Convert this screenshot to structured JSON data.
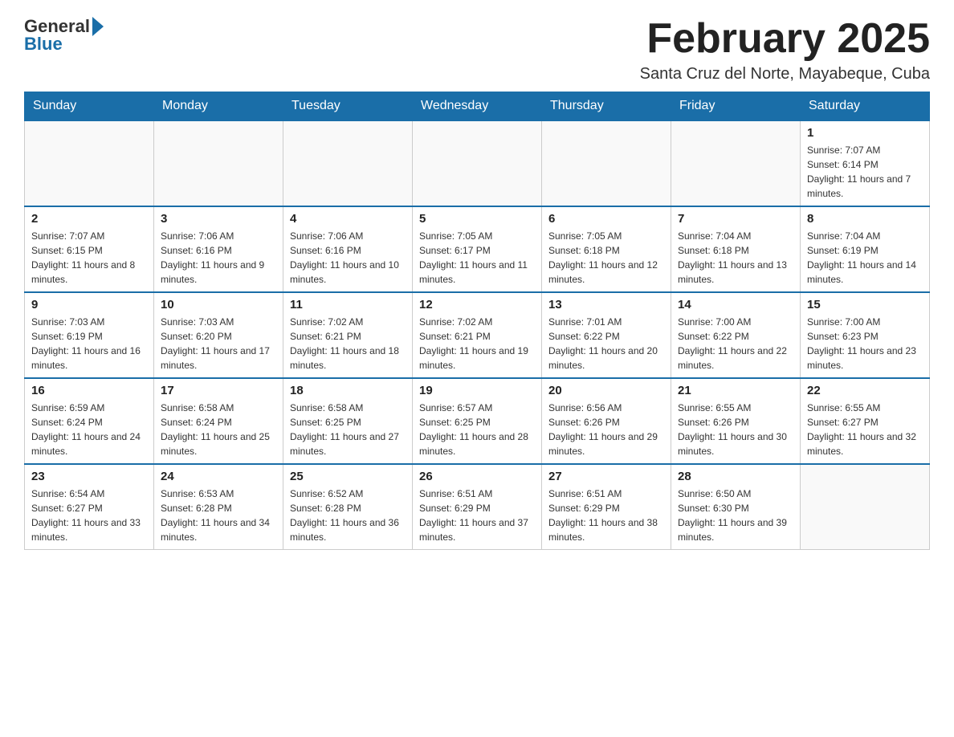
{
  "logo": {
    "general_text": "General",
    "blue_text": "Blue"
  },
  "header": {
    "title": "February 2025",
    "subtitle": "Santa Cruz del Norte, Mayabeque, Cuba"
  },
  "days_of_week": [
    "Sunday",
    "Monday",
    "Tuesday",
    "Wednesday",
    "Thursday",
    "Friday",
    "Saturday"
  ],
  "weeks": [
    {
      "days": [
        {
          "date": "",
          "info": ""
        },
        {
          "date": "",
          "info": ""
        },
        {
          "date": "",
          "info": ""
        },
        {
          "date": "",
          "info": ""
        },
        {
          "date": "",
          "info": ""
        },
        {
          "date": "",
          "info": ""
        },
        {
          "date": "1",
          "info": "Sunrise: 7:07 AM\nSunset: 6:14 PM\nDaylight: 11 hours and 7 minutes."
        }
      ]
    },
    {
      "days": [
        {
          "date": "2",
          "info": "Sunrise: 7:07 AM\nSunset: 6:15 PM\nDaylight: 11 hours and 8 minutes."
        },
        {
          "date": "3",
          "info": "Sunrise: 7:06 AM\nSunset: 6:16 PM\nDaylight: 11 hours and 9 minutes."
        },
        {
          "date": "4",
          "info": "Sunrise: 7:06 AM\nSunset: 6:16 PM\nDaylight: 11 hours and 10 minutes."
        },
        {
          "date": "5",
          "info": "Sunrise: 7:05 AM\nSunset: 6:17 PM\nDaylight: 11 hours and 11 minutes."
        },
        {
          "date": "6",
          "info": "Sunrise: 7:05 AM\nSunset: 6:18 PM\nDaylight: 11 hours and 12 minutes."
        },
        {
          "date": "7",
          "info": "Sunrise: 7:04 AM\nSunset: 6:18 PM\nDaylight: 11 hours and 13 minutes."
        },
        {
          "date": "8",
          "info": "Sunrise: 7:04 AM\nSunset: 6:19 PM\nDaylight: 11 hours and 14 minutes."
        }
      ]
    },
    {
      "days": [
        {
          "date": "9",
          "info": "Sunrise: 7:03 AM\nSunset: 6:19 PM\nDaylight: 11 hours and 16 minutes."
        },
        {
          "date": "10",
          "info": "Sunrise: 7:03 AM\nSunset: 6:20 PM\nDaylight: 11 hours and 17 minutes."
        },
        {
          "date": "11",
          "info": "Sunrise: 7:02 AM\nSunset: 6:21 PM\nDaylight: 11 hours and 18 minutes."
        },
        {
          "date": "12",
          "info": "Sunrise: 7:02 AM\nSunset: 6:21 PM\nDaylight: 11 hours and 19 minutes."
        },
        {
          "date": "13",
          "info": "Sunrise: 7:01 AM\nSunset: 6:22 PM\nDaylight: 11 hours and 20 minutes."
        },
        {
          "date": "14",
          "info": "Sunrise: 7:00 AM\nSunset: 6:22 PM\nDaylight: 11 hours and 22 minutes."
        },
        {
          "date": "15",
          "info": "Sunrise: 7:00 AM\nSunset: 6:23 PM\nDaylight: 11 hours and 23 minutes."
        }
      ]
    },
    {
      "days": [
        {
          "date": "16",
          "info": "Sunrise: 6:59 AM\nSunset: 6:24 PM\nDaylight: 11 hours and 24 minutes."
        },
        {
          "date": "17",
          "info": "Sunrise: 6:58 AM\nSunset: 6:24 PM\nDaylight: 11 hours and 25 minutes."
        },
        {
          "date": "18",
          "info": "Sunrise: 6:58 AM\nSunset: 6:25 PM\nDaylight: 11 hours and 27 minutes."
        },
        {
          "date": "19",
          "info": "Sunrise: 6:57 AM\nSunset: 6:25 PM\nDaylight: 11 hours and 28 minutes."
        },
        {
          "date": "20",
          "info": "Sunrise: 6:56 AM\nSunset: 6:26 PM\nDaylight: 11 hours and 29 minutes."
        },
        {
          "date": "21",
          "info": "Sunrise: 6:55 AM\nSunset: 6:26 PM\nDaylight: 11 hours and 30 minutes."
        },
        {
          "date": "22",
          "info": "Sunrise: 6:55 AM\nSunset: 6:27 PM\nDaylight: 11 hours and 32 minutes."
        }
      ]
    },
    {
      "days": [
        {
          "date": "23",
          "info": "Sunrise: 6:54 AM\nSunset: 6:27 PM\nDaylight: 11 hours and 33 minutes."
        },
        {
          "date": "24",
          "info": "Sunrise: 6:53 AM\nSunset: 6:28 PM\nDaylight: 11 hours and 34 minutes."
        },
        {
          "date": "25",
          "info": "Sunrise: 6:52 AM\nSunset: 6:28 PM\nDaylight: 11 hours and 36 minutes."
        },
        {
          "date": "26",
          "info": "Sunrise: 6:51 AM\nSunset: 6:29 PM\nDaylight: 11 hours and 37 minutes."
        },
        {
          "date": "27",
          "info": "Sunrise: 6:51 AM\nSunset: 6:29 PM\nDaylight: 11 hours and 38 minutes."
        },
        {
          "date": "28",
          "info": "Sunrise: 6:50 AM\nSunset: 6:30 PM\nDaylight: 11 hours and 39 minutes."
        },
        {
          "date": "",
          "info": ""
        }
      ]
    }
  ]
}
